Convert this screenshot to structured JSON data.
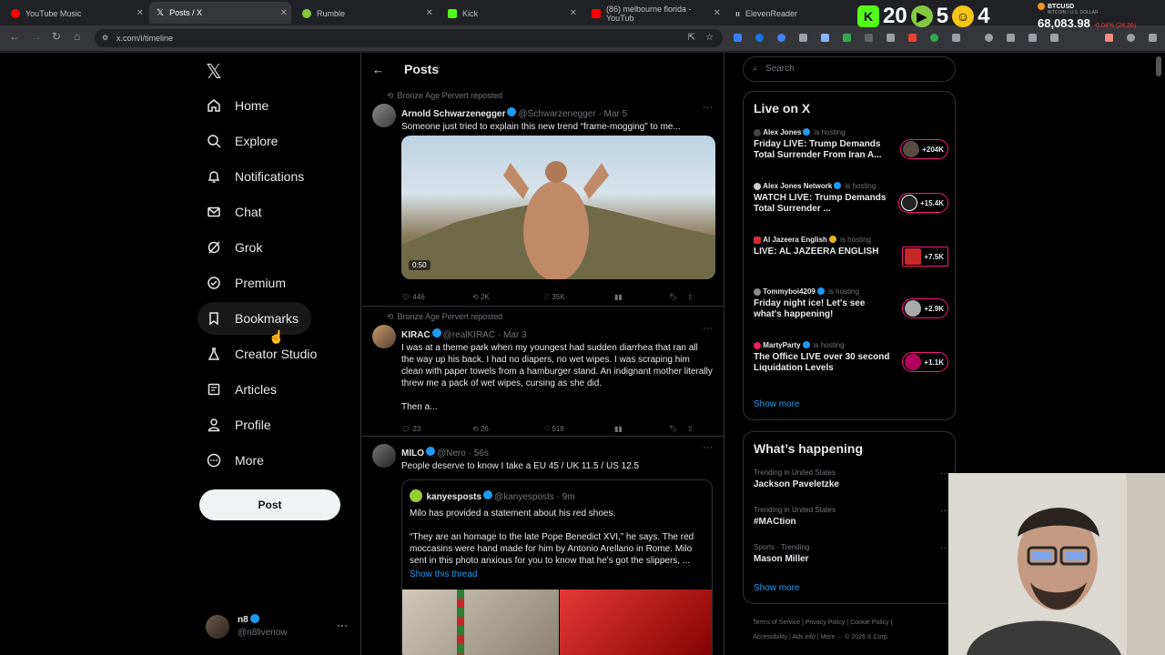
{
  "browser": {
    "tabs": [
      {
        "label": "YouTube Music",
        "color": "#ff0000"
      },
      {
        "label": "Posts / X",
        "color": "#ffffff"
      },
      {
        "label": "Rumble",
        "color": "#85c742"
      },
      {
        "label": "Kick",
        "color": "#53fc18"
      },
      {
        "label": "(86) melbourne florida - YouTub",
        "color": "#ff0000"
      },
      {
        "label": "ElevenReader",
        "color": "#ffffff"
      }
    ],
    "url": "x.com/i/timeline"
  },
  "overlay": {
    "kick_count": "20",
    "rumble_count": "5",
    "viewer_count": "4",
    "btc_label": "BTCUSD",
    "btc_sub": "BITCOIN / U.S. DOLLAR",
    "btc_price": "68,083.98",
    "btc_change": "-0.04% (24.26)"
  },
  "nav": {
    "items": [
      {
        "label": "Home",
        "icon": "home-icon"
      },
      {
        "label": "Explore",
        "icon": "search-icon"
      },
      {
        "label": "Notifications",
        "icon": "bell-icon"
      },
      {
        "label": "Chat",
        "icon": "mail-icon"
      },
      {
        "label": "Grok",
        "icon": "grok-icon"
      },
      {
        "label": "Premium",
        "icon": "verified-icon"
      },
      {
        "label": "Bookmarks",
        "icon": "bookmark-icon"
      },
      {
        "label": "Creator Studio",
        "icon": "flask-icon"
      },
      {
        "label": "Articles",
        "icon": "article-icon"
      },
      {
        "label": "Profile",
        "icon": "person-icon"
      },
      {
        "label": "More",
        "icon": "more-circle-icon"
      }
    ],
    "post_button": "Post",
    "user": {
      "name": "n8",
      "handle": "@n8livenow"
    }
  },
  "feed": {
    "title": "Posts",
    "posts": [
      {
        "repost_by": "Bronze Age Pervert reposted",
        "name": "Arnold Schwarzenegger",
        "handle": "@Schwarzenegger · Mar 5",
        "text": "Someone just tried to explain this new trend “frame-mogging” to me...",
        "video_time": "0:50",
        "replies": "446",
        "reposts": "2K",
        "likes": "35K"
      },
      {
        "repost_by": "Bronze Age Pervert reposted",
        "name": "KIRAC",
        "handle": "@realKIRAC · Mar 3",
        "text": "I was at a theme park when my youngest had sudden diarrhea that ran all the way up his back. I had no diapers, no wet wipes. I was scraping him clean with paper towels from a hamburger stand. An indignant mother literally threw me a pack of wet wipes, cursing as she did.",
        "text2": "Then a...",
        "replies": "23",
        "reposts": "26",
        "likes": "518"
      },
      {
        "name": "MILO",
        "handle": "@Nero · 56s",
        "text": "People deserve to know I take a EU 45 / UK 11.5 / US 12.5",
        "quote": {
          "name": "kanyesposts",
          "handle": "@kanyesposts · 9m",
          "line1": "Milo has provided a statement about his red shoes.",
          "line2": "“They are an homage to the late Pope Benedict XVI,” he says. The red moccasins were hand made for him by Antonio Arellano in Rome. Milo sent in this photo anxious for you to know that he's got the slippers, ...",
          "show_thread": "Show this thread"
        }
      }
    ]
  },
  "right": {
    "search_placeholder": "Search",
    "live_title": "Live on X",
    "live": [
      {
        "host": "Alex Jones",
        "status": "is hosting",
        "title": "Friday LIVE: Trump Demands Total Surrender From Iran A...",
        "count": "+204K"
      },
      {
        "host": "Alex Jones Network",
        "status": "is hosting",
        "title": "WATCH LIVE: Trump Demands Total Surrender ...",
        "count": "+15.4K"
      },
      {
        "host": "Al Jazeera English",
        "status": "is hosting",
        "title": "LIVE: AL JAZEERA ENGLISH",
        "count": "+7.5K"
      },
      {
        "host": "Tommyboi4209",
        "status": "is hosting",
        "title": "Friday night ice! Let's see what's happening!",
        "count": "+2.9K"
      },
      {
        "host": "MartyParty",
        "status": "is hosting",
        "title": "The Office LIVE over 30 second Liquidation Levels",
        "count": "+1.1K"
      }
    ],
    "live_show_more": "Show more",
    "happening_title": "What’s happening",
    "trends": [
      {
        "meta": "Trending in United States",
        "name": "Jackson Paveletzke"
      },
      {
        "meta": "Trending in United States",
        "name": "#MACtion"
      },
      {
        "meta": "Sports · Trending",
        "name": "Mason Miller"
      }
    ],
    "trends_show_more": "Show more",
    "footer_line1": "Terms of Service  |  Privacy Policy  |  Cookie Policy  |",
    "footer_line2": "Accessibility  |  Ads info  |  More ···  © 2026 X Corp."
  }
}
